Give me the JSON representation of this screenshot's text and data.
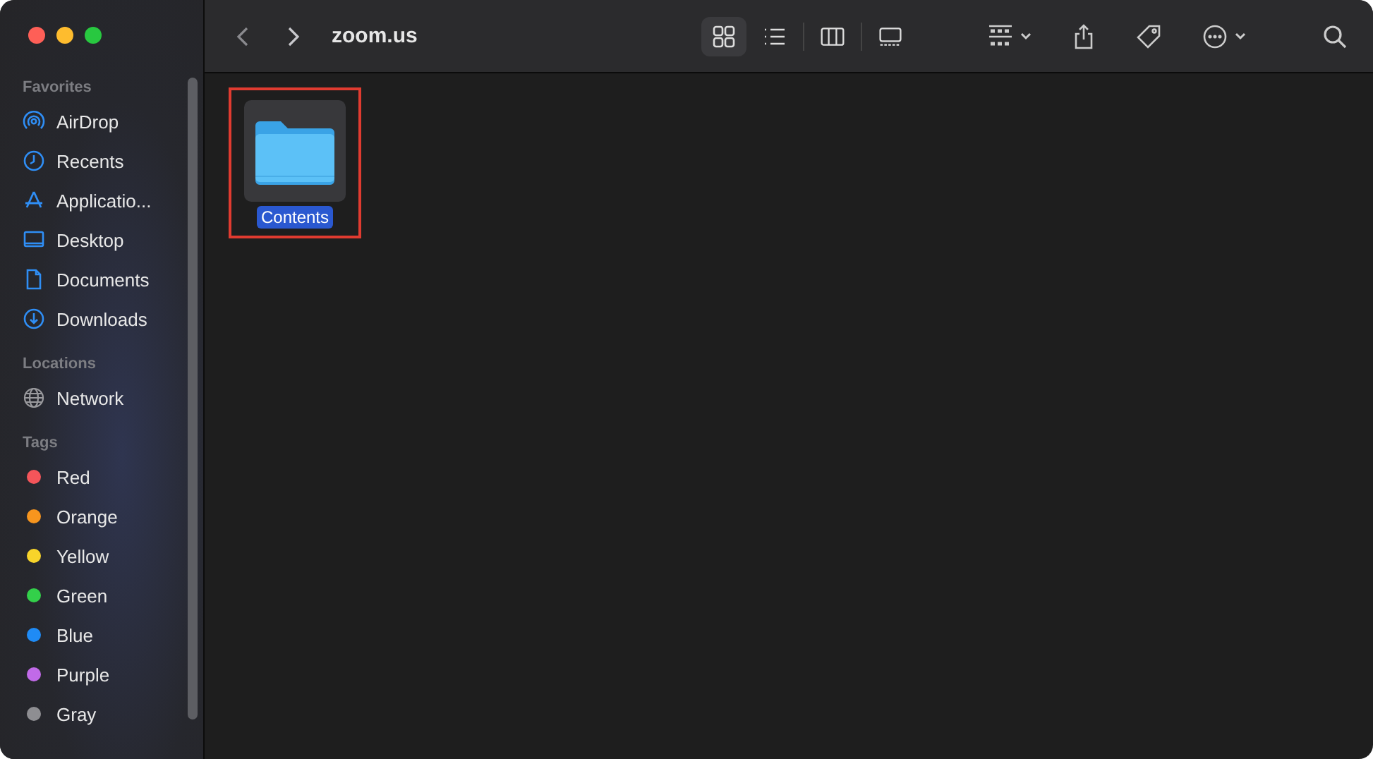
{
  "window": {
    "title": "zoom.us"
  },
  "sidebar": {
    "sections": [
      {
        "title": "Favorites",
        "items": [
          {
            "label": "AirDrop",
            "kind": "airdrop"
          },
          {
            "label": "Recents",
            "kind": "clock"
          },
          {
            "label": "Applicatio...",
            "kind": "apps"
          },
          {
            "label": "Desktop",
            "kind": "desktop"
          },
          {
            "label": "Documents",
            "kind": "document"
          },
          {
            "label": "Downloads",
            "kind": "download"
          }
        ]
      },
      {
        "title": "Locations",
        "items": [
          {
            "label": "Network",
            "kind": "globe"
          }
        ]
      },
      {
        "title": "Tags",
        "items": [
          {
            "label": "Red",
            "kind": "tag",
            "color": "#f4555a"
          },
          {
            "label": "Orange",
            "kind": "tag",
            "color": "#f7951e"
          },
          {
            "label": "Yellow",
            "kind": "tag",
            "color": "#f8d42a"
          },
          {
            "label": "Green",
            "kind": "tag",
            "color": "#33d04a"
          },
          {
            "label": "Blue",
            "kind": "tag",
            "color": "#1f8bf5"
          },
          {
            "label": "Purple",
            "kind": "tag",
            "color": "#c16ae8"
          },
          {
            "label": "Gray",
            "kind": "tag",
            "color": "#8e8e92"
          }
        ]
      }
    ]
  },
  "view_modes": [
    {
      "kind": "icons",
      "selected": true
    },
    {
      "kind": "list",
      "selected": false
    },
    {
      "kind": "columns",
      "selected": false
    },
    {
      "kind": "gallery",
      "selected": false
    }
  ],
  "files": [
    {
      "name": "Contents",
      "selected": true,
      "highlighted": true
    }
  ]
}
